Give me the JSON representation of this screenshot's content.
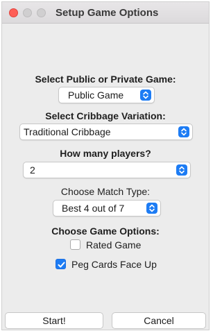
{
  "window": {
    "title": "Setup Game Options"
  },
  "game_type": {
    "heading": "Select Public or Private Game:",
    "selected": "Public Game"
  },
  "variation": {
    "heading": "Select Cribbage Variation:",
    "selected": "Traditional Cribbage"
  },
  "players": {
    "heading": "How many players?",
    "selected": "2"
  },
  "match_type": {
    "heading": "Choose Match Type:",
    "selected": "Best 4 out of 7"
  },
  "options": {
    "heading": "Choose Game Options:",
    "rated_label": "Rated Game",
    "rated_checked": false,
    "peg_label": "Peg Cards Face Up",
    "peg_checked": true
  },
  "buttons": {
    "start": "Start!",
    "cancel": "Cancel"
  },
  "colors": {
    "accent": "#1d7cf4",
    "close": "#fe5f57"
  }
}
